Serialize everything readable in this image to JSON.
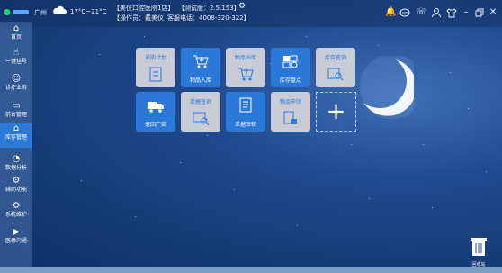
{
  "topbar": {
    "city": "广州",
    "temp": "17°C~21°C",
    "shop": "【美仪口腔医院1店】",
    "version": "【测试版：2.5.153】",
    "operator": "【操作员：戴美仪",
    "hotline": "客服电话：4008-320-322】",
    "icons": [
      "bell-icon",
      "message-icon",
      "phone-icon",
      "user-icon",
      "shirt-icon",
      "minimize-icon",
      "restore-icon",
      "close-icon"
    ]
  },
  "sidebar": {
    "items": [
      {
        "label": "首页",
        "icon": "home-icon"
      },
      {
        "label": "一键挂号",
        "icon": "register-icon"
      },
      {
        "label": "诊疗业务",
        "icon": "clinic-icon"
      },
      {
        "label": "前台管理",
        "icon": "reception-icon"
      },
      {
        "label": "库存管理",
        "icon": "inventory-icon",
        "active": true
      },
      {
        "label": "数据分析",
        "icon": "analytics-icon"
      },
      {
        "label": "辅助功能",
        "icon": "tools-icon"
      },
      {
        "label": "系统维护",
        "icon": "system-icon"
      },
      {
        "label": "医患沟通",
        "icon": "video-icon"
      }
    ]
  },
  "tiles": [
    {
      "label": "采购计划",
      "style": "grey"
    },
    {
      "label": "物品入库",
      "style": "blue"
    },
    {
      "label": "物品出库",
      "style": "grey"
    },
    {
      "label": "库存盘点",
      "style": "blue"
    },
    {
      "label": "库存查询",
      "style": "grey"
    },
    {
      "label": "退回厂商",
      "style": "blue"
    },
    {
      "label": "单据查询",
      "style": "grey"
    },
    {
      "label": "单据审核",
      "style": "blue"
    },
    {
      "label": "物品申领",
      "style": "grey"
    }
  ],
  "add_tile": {
    "label": "+"
  },
  "trash": {
    "label": "回收站"
  },
  "colors": {
    "accent": "#2b78d8",
    "grey_tile": "#c7ccd6",
    "background": "#1f4a8e"
  }
}
